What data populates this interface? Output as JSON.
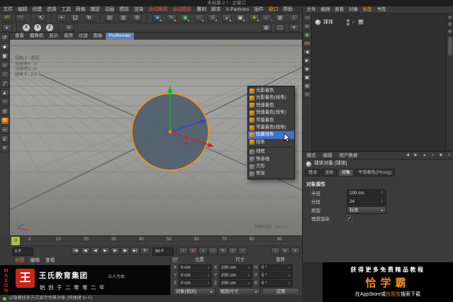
{
  "window": {
    "title": "未标题 2 * - 主窗口"
  },
  "colors": {
    "selection_orange": "#ff9400",
    "highlight_blue": "#3f72c8",
    "timeline_marker_green": "#a9c23f",
    "logo_red": "#c5281c",
    "promo_orange": "#f08c1e",
    "prorender_blue": "#5b82b8"
  },
  "menubar": {
    "items": [
      {
        "label": "文件"
      },
      {
        "label": "编辑"
      },
      {
        "label": "创建"
      },
      {
        "label": "选择"
      },
      {
        "label": "工具"
      },
      {
        "label": "网格"
      },
      {
        "label": "捕捉"
      },
      {
        "label": "动画"
      },
      {
        "label": "模拟"
      },
      {
        "label": "渲染"
      },
      {
        "label": "运动跟踪"
      },
      {
        "label": "运动图形"
      },
      {
        "label": "雕刻"
      },
      {
        "label": "脚本"
      },
      {
        "label": "X-Particles"
      },
      {
        "label": "插件"
      },
      {
        "label": "窗口"
      },
      {
        "label": "帮助"
      }
    ]
  },
  "toolbar": {
    "row1": [
      {
        "name": "undo-icon",
        "glyph": "↶"
      },
      {
        "name": "redo-icon",
        "glyph": "↷"
      },
      {
        "name": "live-selection-icon",
        "glyph": "↖"
      },
      {
        "name": "move-tool-icon",
        "glyph": "+"
      },
      {
        "name": "scale-tool-icon",
        "glyph": "◱"
      },
      {
        "name": "rotate-tool-icon",
        "glyph": "↻"
      },
      {
        "name": "render-view-icon",
        "glyph": "▤"
      },
      {
        "name": "render-picture-viewer-icon",
        "glyph": "▥"
      },
      {
        "name": "render-settings-icon",
        "glyph": "⚙"
      },
      {
        "name": "add-cube-icon",
        "glyph": "■"
      },
      {
        "name": "spline-pen-icon",
        "glyph": "✎"
      },
      {
        "name": "subdivision-surface-icon",
        "glyph": "◉"
      },
      {
        "name": "array-generator-icon",
        "glyph": "∷"
      },
      {
        "name": "deformer-icon",
        "glyph": "S"
      },
      {
        "name": "environment-icon",
        "glyph": "▲"
      },
      {
        "name": "camera-icon",
        "glyph": "▣"
      },
      {
        "name": "light-icon",
        "glyph": "☀"
      },
      {
        "name": "xparticles-icon",
        "glyph": "X"
      }
    ],
    "row1_right": [
      {
        "name": "snap-magnet-icon",
        "glyph": "∪"
      },
      {
        "name": "workplane-icon",
        "glyph": "▦"
      },
      {
        "name": "axis-mode-icon",
        "glyph": "⊥"
      }
    ],
    "row2_left": [
      {
        "name": "tweak-tool-icon",
        "glyph": "●"
      },
      {
        "name": "lock-x-button",
        "glyph": "X"
      },
      {
        "name": "lock-y-button",
        "glyph": "Y"
      },
      {
        "name": "lock-z-button",
        "glyph": "Z"
      },
      {
        "name": "coordinate-system-button",
        "glyph": "⊕"
      }
    ],
    "row2_right": [
      {
        "name": "viewport-config-icon",
        "glyph": "▦"
      },
      {
        "name": "layout-icon",
        "glyph": "▢"
      },
      {
        "name": "toolbar-menu-icon",
        "glyph": "≡"
      }
    ]
  },
  "left_palette": {
    "icons": [
      {
        "name": "make-editable-icon",
        "glyph": "↺"
      },
      {
        "name": "model-mode-icon",
        "glyph": "◆"
      },
      {
        "name": "texture-mode-icon",
        "glyph": "▦"
      },
      {
        "name": "workplane-mode-icon",
        "glyph": "▱"
      },
      {
        "name": "points-mode-icon",
        "glyph": "∴"
      },
      {
        "name": "edges-mode-icon",
        "glyph": "╱"
      },
      {
        "name": "polygons-mode-icon",
        "glyph": "▲"
      },
      {
        "name": "enable-axis-icon",
        "glyph": "+"
      },
      {
        "name": "viewport-solo-icon",
        "glyph": "◎"
      },
      {
        "name": "snap-toggle-icon",
        "glyph": "S"
      },
      {
        "name": "workplane-lock-icon",
        "glyph": "▭"
      },
      {
        "name": "quantize-icon",
        "glyph": "∠"
      },
      {
        "name": "modeling-settings-icon",
        "glyph": "≡"
      }
    ]
  },
  "viewport": {
    "menu": [
      "查看",
      "摄像机",
      "显示",
      "选项",
      "过滤",
      "面板"
    ],
    "prorender": "ProRender",
    "hud": [
      "视图 2 : 透视",
      "分辨率H : 0",
      "分辨率V : 0",
      "帧率 F : 0.0"
    ],
    "grid_label": "网格间距: 100 cm"
  },
  "context_menu": {
    "items": [
      {
        "label": "光影着色"
      },
      {
        "label": "光影着色(线条)"
      },
      {
        "label": "快速着色"
      },
      {
        "label": "快速着色(线条)"
      },
      {
        "label": "常量着色"
      },
      {
        "label": "常量着色(线条)"
      },
      {
        "label": "隐藏线条"
      },
      {
        "label": "线条"
      },
      {
        "label": "线框"
      },
      {
        "label": "等参线"
      },
      {
        "label": "方形"
      },
      {
        "label": "骨架"
      }
    ],
    "highlight_index": 6
  },
  "object_manager": {
    "menus": [
      "文件",
      "编辑",
      "查看",
      "对象",
      "标签",
      "书签"
    ],
    "strip_icons": [
      {
        "name": "om-axis-icon",
        "glyph": "+"
      },
      {
        "name": "om-world-icon",
        "glyph": "⊕"
      },
      {
        "name": "om-model-icon",
        "glyph": "◆"
      },
      {
        "name": "om-psr-icon",
        "glyph": "PSR"
      },
      {
        "name": "om-prev-icon",
        "glyph": "◀"
      },
      {
        "name": "om-next-icon",
        "glyph": "▶"
      },
      {
        "name": "om-key-icon",
        "glyph": "◆"
      },
      {
        "name": "om-cam-icon",
        "glyph": "▣"
      },
      {
        "name": "om-film-icon",
        "glyph": "▤"
      },
      {
        "name": "om-tag-icon",
        "glyph": "□"
      }
    ],
    "objects": [
      {
        "name": "球体"
      }
    ],
    "scroll_icons": [
      {
        "name": "om-search-icon",
        "glyph": "⌕"
      },
      {
        "name": "om-filter-icon",
        "glyph": "▽"
      },
      {
        "name": "om-list-icon",
        "glyph": "≡"
      }
    ]
  },
  "attributes": {
    "menus": [
      "模式",
      "编辑",
      "用户数据"
    ],
    "header_icons": [
      {
        "name": "am-back-icon",
        "glyph": "◀"
      },
      {
        "name": "am-forward-icon",
        "glyph": "▶"
      },
      {
        "name": "am-up-icon",
        "glyph": "▲"
      },
      {
        "name": "am-search-icon",
        "glyph": "⌕"
      },
      {
        "name": "am-lock-icon",
        "glyph": "◉"
      },
      {
        "name": "am-menu-icon",
        "glyph": "≡"
      }
    ],
    "title": "球体对象 [球体]",
    "tabs": [
      "基本",
      "坐标",
      "对象",
      "平滑着色(Phong)"
    ],
    "active_tab": "对象",
    "section": "对象属性",
    "rows": [
      {
        "label": "半径",
        "value": "100 cm"
      },
      {
        "label": "分段",
        "value": "24"
      },
      {
        "label": "类型",
        "value": "标准"
      },
      {
        "label": "理想渲染",
        "value": "✓"
      }
    ]
  },
  "timeline": {
    "ticks": [
      "0",
      "10",
      "20",
      "30",
      "40",
      "50",
      "60",
      "70",
      "80",
      "90"
    ],
    "current": "0",
    "start_field": "0 F",
    "end_field": "90 F",
    "transport": [
      {
        "name": "goto-start-button",
        "glyph": "|◀"
      },
      {
        "name": "prev-key-button",
        "glyph": "◀|"
      },
      {
        "name": "prev-frame-button",
        "glyph": "◀"
      },
      {
        "name": "play-button",
        "glyph": "▶"
      },
      {
        "name": "next-frame-button",
        "glyph": "▶"
      },
      {
        "name": "next-key-button",
        "glyph": "|▶"
      },
      {
        "name": "goto-end-button",
        "glyph": "▶|"
      },
      {
        "name": "loop-button",
        "glyph": "↻"
      }
    ],
    "record_icons": [
      {
        "name": "record-keyframe-button",
        "glyph": "●"
      },
      {
        "name": "autokey-button",
        "glyph": "◉"
      },
      {
        "name": "record-position-button",
        "glyph": "+"
      },
      {
        "name": "record-scale-button",
        "glyph": "□"
      },
      {
        "name": "record-rotation-button",
        "glyph": "↻"
      },
      {
        "name": "record-parameter-button",
        "glyph": "◇"
      },
      {
        "name": "record-pla-button",
        "glyph": "~"
      },
      {
        "name": "sound-toggle-button",
        "glyph": "♪"
      },
      {
        "name": "playback-rate-button",
        "glyph": "▸"
      },
      {
        "name": "timeline-options-button",
        "glyph": "≡"
      }
    ]
  },
  "materials": {
    "menus": [
      "创建",
      "编辑",
      "查看"
    ]
  },
  "coordinates": {
    "headers": [
      "位置",
      "尺寸",
      "旋转"
    ],
    "rows": [
      {
        "pos_axis": "X",
        "pos": "0 cm",
        "size_axis": "X",
        "size": "200 cm",
        "rot_axis": "H",
        "rot": "0 °"
      },
      {
        "pos_axis": "Y",
        "pos": "0 cm",
        "size_axis": "Y",
        "size": "200 cm",
        "rot_axis": "P",
        "rot": "0 °"
      },
      {
        "pos_axis": "Z",
        "pos": "0 cm",
        "size_axis": "Z",
        "size": "200 cm",
        "rot_axis": "B",
        "rot": "0 °"
      }
    ],
    "mode": "对象(相对)",
    "size_mode": "缩放尺寸",
    "apply": "应用"
  },
  "branding": {
    "maxon": "MAXON",
    "logo_char": "王",
    "name": "王氏教育集团",
    "slogan": "以人为本",
    "line2": "始创于二零零二年"
  },
  "promo": {
    "line1": "获得更多免费精品教程",
    "title": "恰学霸",
    "line3_prefix": "在AppStore或",
    "line3_highlight": "应用宝",
    "line3_suffix": "搜索下载"
  },
  "status": {
    "text": "以隐藏线条方式显示场景对象 (快捷键 N~F)"
  }
}
